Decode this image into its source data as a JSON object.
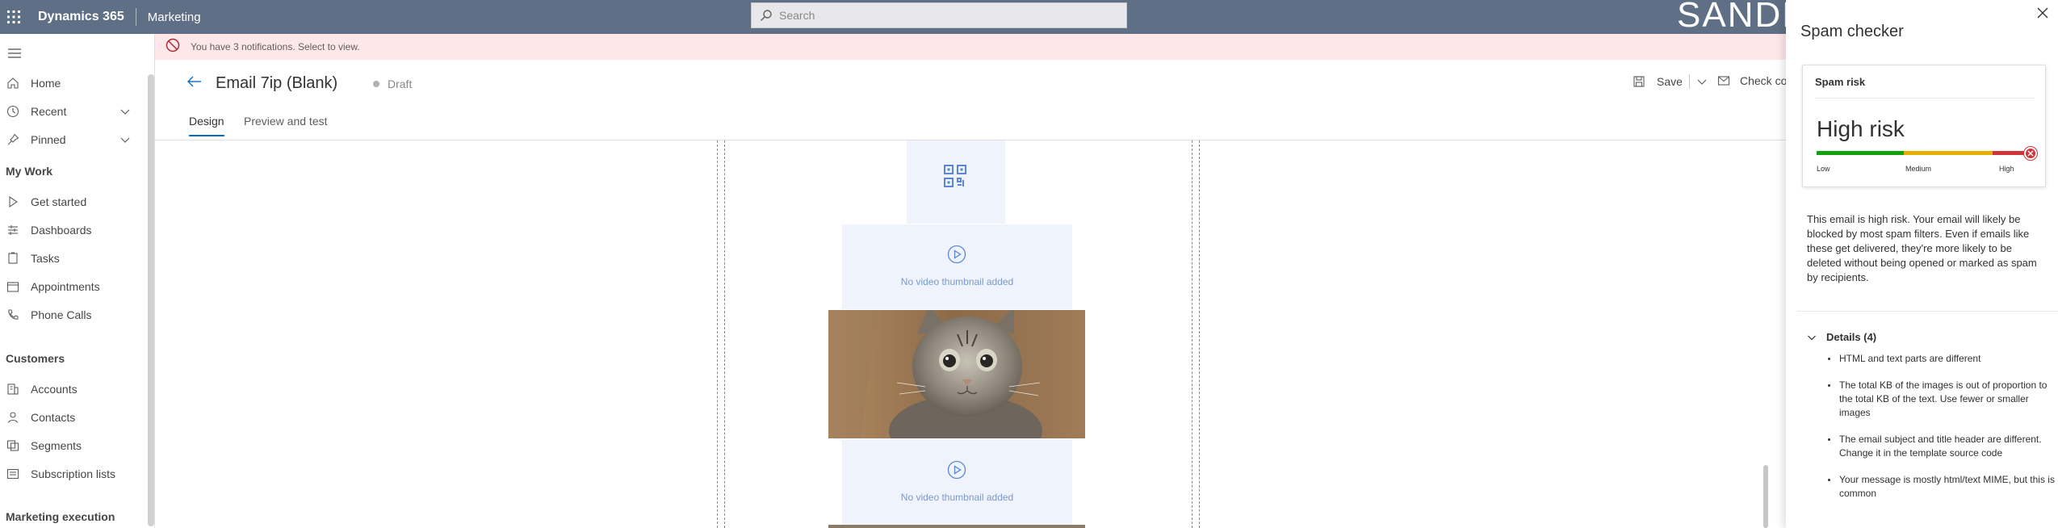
{
  "topbar": {
    "app_name": "Dynamics 365",
    "module": "Marketing",
    "search_placeholder": "Search",
    "environment_banner": "SANDBOX"
  },
  "notification": {
    "text": "You have 3 notifications. Select to view."
  },
  "sidebar": {
    "items_top": [
      {
        "label": "Home",
        "icon": "home-icon"
      },
      {
        "label": "Recent",
        "icon": "clock-icon",
        "expandable": true
      },
      {
        "label": "Pinned",
        "icon": "pin-icon",
        "expandable": true
      }
    ],
    "sections": [
      {
        "title": "My Work",
        "items": [
          {
            "label": "Get started",
            "icon": "play-icon"
          },
          {
            "label": "Dashboards",
            "icon": "dashboard-icon"
          },
          {
            "label": "Tasks",
            "icon": "task-icon"
          },
          {
            "label": "Appointments",
            "icon": "calendar-icon"
          },
          {
            "label": "Phone Calls",
            "icon": "phone-icon"
          }
        ]
      },
      {
        "title": "Customers",
        "items": [
          {
            "label": "Accounts",
            "icon": "building-icon"
          },
          {
            "label": "Contacts",
            "icon": "person-icon"
          },
          {
            "label": "Segments",
            "icon": "segments-icon"
          },
          {
            "label": "Subscription lists",
            "icon": "list-icon"
          }
        ]
      },
      {
        "title": "Marketing execution",
        "items": []
      }
    ]
  },
  "header": {
    "title": "Email 7ip (Blank)",
    "status": "Draft",
    "save_label": "Save",
    "check_label": "Check con"
  },
  "tabs": [
    {
      "label": "Design",
      "active": true
    },
    {
      "label": "Preview and test",
      "active": false
    }
  ],
  "canvas": {
    "video_placeholder_1": "No video thumbnail added",
    "video_placeholder_2": "No video thumbnail added"
  },
  "spam_panel": {
    "title": "Spam checker",
    "card_label": "Spam risk",
    "risk_level": "High risk",
    "meter_value": "high",
    "meter_labels": {
      "low": "Low",
      "medium": "Medium",
      "high": "High"
    },
    "description": "This email is high risk. Your email will likely be blocked by most spam filters. Even if emails like these get delivered, they're more likely to be deleted without being opened or marked as spam by recipients.",
    "details_label": "Details (4)",
    "details": [
      "HTML and text parts are different",
      "The total KB of the images is out of proportion to the total KB of the text. Use fewer or smaller images",
      "The email subject and title header are different. Change it in the template source code",
      "Your message is mostly html/text MIME, but this is common"
    ]
  },
  "colors": {
    "topbar": "#5f6f85",
    "accent": "#0f6cbd",
    "notification_bg": "#fde7e9",
    "risk_low": "#13a10e",
    "risk_medium": "#e3b000",
    "risk_high": "#d13438"
  }
}
